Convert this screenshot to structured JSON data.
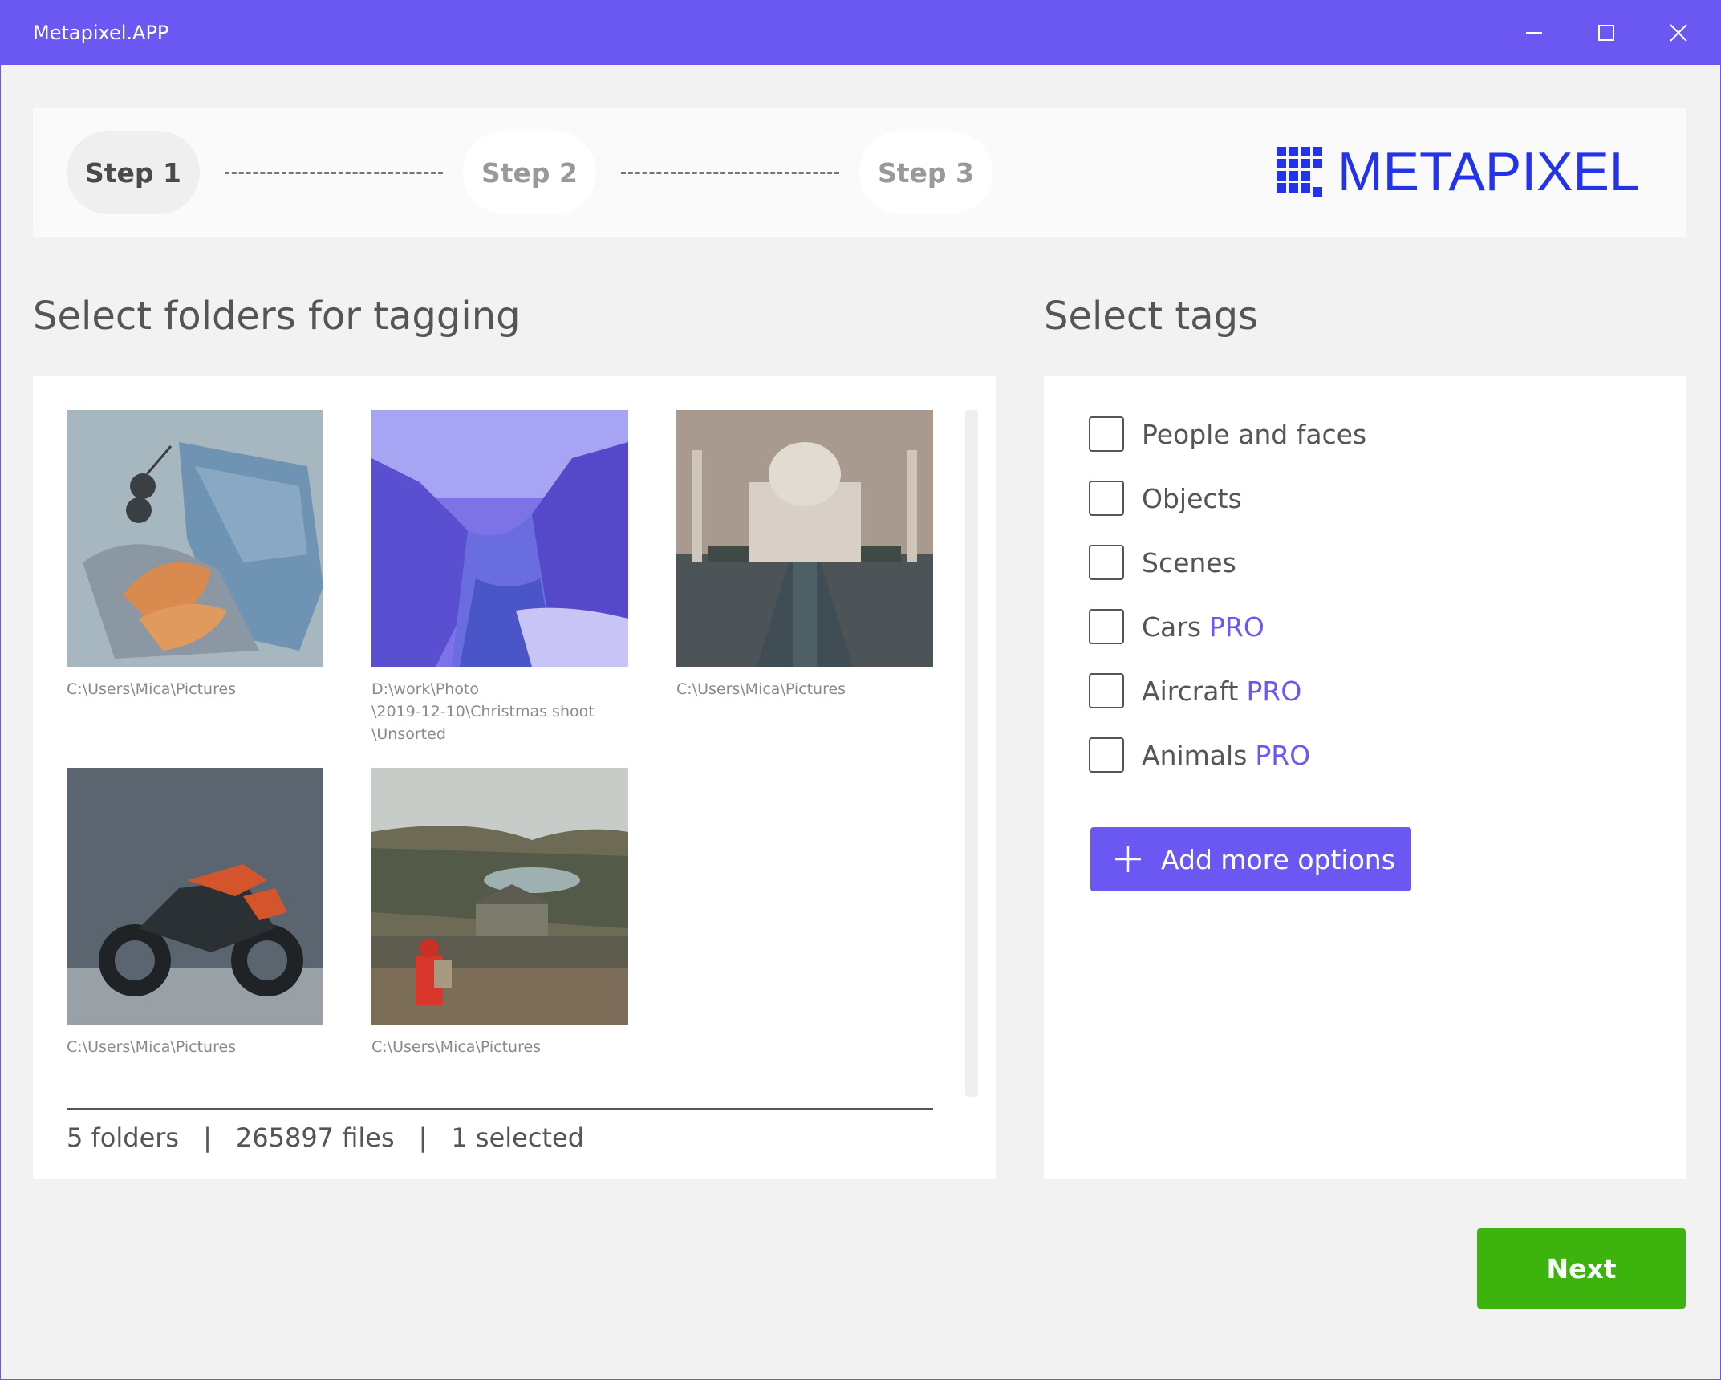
{
  "window": {
    "title": "Metapixel.APP",
    "controls": {
      "minimize": "minimize-icon",
      "maximize": "maximize-icon",
      "close": "close-icon"
    }
  },
  "stepper": {
    "steps": [
      {
        "label": "Step 1",
        "active": true
      },
      {
        "label": "Step 2",
        "active": false
      },
      {
        "label": "Step 3",
        "active": false
      }
    ],
    "logo_text": "METAPIXEL"
  },
  "folders": {
    "title": "Select folders for tagging",
    "items": [
      {
        "path": "C:\\Users\\Mica\\Pictures",
        "image": "jeans-sunglasses-shoes-photo"
      },
      {
        "path": "D:\\work\\Photo\n\\2019-12-10\\Christmas shoot\n\\Unsorted",
        "image": "snowy-river-forest-photo"
      },
      {
        "path": "C:\\Users\\Mica\\Pictures",
        "image": "taj-mahal-photo"
      },
      {
        "path": "C:\\Users\\Mica\\Pictures",
        "image": "motorcycle-photo"
      },
      {
        "path": "C:\\Users\\Mica\\Pictures",
        "image": "hiker-landscape-photo"
      }
    ],
    "summary": {
      "folders": "5 folders",
      "files": "265897 files",
      "selected": "1 selected",
      "separator": "|"
    }
  },
  "tags": {
    "title": "Select tags",
    "items": [
      {
        "label": "People and faces",
        "pro": "",
        "checked": false
      },
      {
        "label": "Objects",
        "pro": "",
        "checked": false
      },
      {
        "label": "Scenes",
        "pro": "",
        "checked": false
      },
      {
        "label": "Cars",
        "pro": "PRO",
        "checked": false
      },
      {
        "label": "Aircraft",
        "pro": "PRO",
        "checked": false
      },
      {
        "label": "Animals",
        "pro": "PRO",
        "checked": false
      }
    ],
    "add_button": "Add more options"
  },
  "next_button": "Next",
  "colors": {
    "accent": "#6b58f2",
    "logo": "#2333e8",
    "next": "#3db30d",
    "background": "#f2f2f2"
  }
}
